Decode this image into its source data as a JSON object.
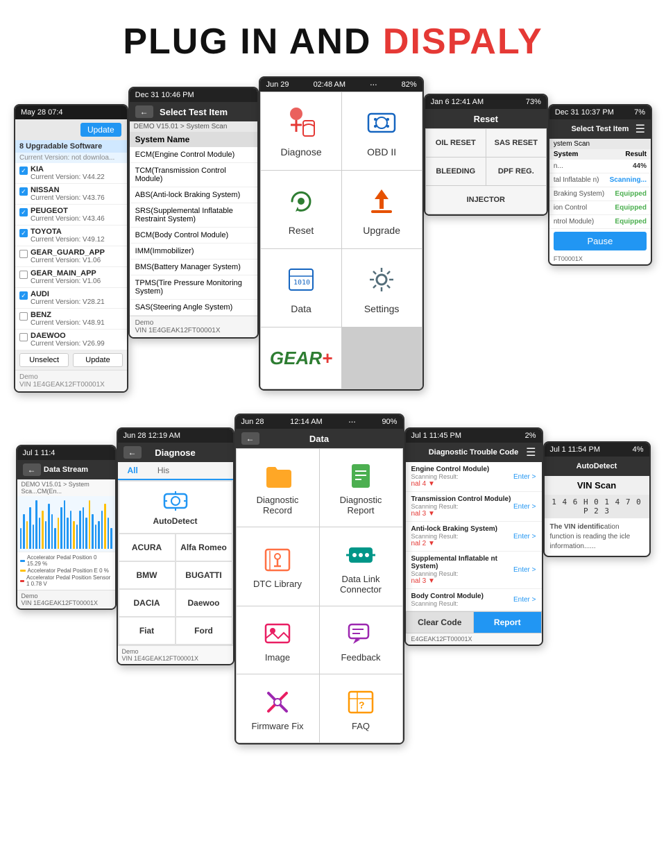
{
  "header": {
    "title_black": "PLUG IN AND ",
    "title_red": "DISPALY"
  },
  "top_row": {
    "update_screen": {
      "status": "May 28  07:4",
      "btn_label": "Update",
      "upgradable": "8 Upgradable Software",
      "current_version": "Current Version: not downloa...",
      "items": [
        {
          "name": "KIA",
          "version": "Current Version: V44.22",
          "checked": true
        },
        {
          "name": "NISSAN",
          "version": "Current Version: V43.76",
          "checked": true
        },
        {
          "name": "PEUGEOT",
          "version": "Current Version: V43.46",
          "checked": true
        },
        {
          "name": "TOYOTA",
          "version": "Current Version: V49.12",
          "checked": true
        },
        {
          "name": "GEAR_GUARD_APP",
          "version": "Current Version: V1.06",
          "checked": false
        },
        {
          "name": "GEAR_MAIN_APP",
          "version": "Current Version: V1.06",
          "checked": false
        },
        {
          "name": "AUDI",
          "version": "Current Version: V28.21",
          "checked": true
        },
        {
          "name": "BENZ",
          "version": "Current Version: V48.91",
          "checked": false
        },
        {
          "name": "DAEWOO",
          "version": "Current Version: V26.99",
          "checked": false
        }
      ],
      "demo": "Demo",
      "vin": "VIN 1E4GEAK12FT00001X",
      "unselect": "Unselect",
      "update": "Update"
    },
    "select_screen": {
      "status": "Dec 31  10:46 PM",
      "title": "Select Test Item",
      "demo_path": "DEMO V15.01 > System Scan",
      "system_name_header": "System Name",
      "items": [
        "ECM(Engine Control Module)",
        "TCM(Transmission Control Module)",
        "ABS(Anti-lock Braking System)",
        "SRS(Supplemental Inflatable Restraint System)",
        "BCM(Body Control Module)",
        "IMM(Immobilizer)",
        "BMS(Battery Manager System)",
        "TPMS(Tire Pressure Monitoring System)",
        "SAS(Steering Angle System)"
      ],
      "demo": "Demo",
      "vin": "VIN 1E4GEAK12FT00001X"
    },
    "main_menu": {
      "status_date": "Jun 29",
      "status_time": "02:48 AM",
      "status_wifi": "WiFi",
      "status_bat": "82%",
      "items": [
        {
          "label": "Diagnose",
          "icon": "diagnose"
        },
        {
          "label": "OBD II",
          "icon": "obd"
        },
        {
          "label": "Reset",
          "icon": "reset"
        },
        {
          "label": "Upgrade",
          "icon": "upgrade"
        },
        {
          "label": "Data",
          "icon": "data"
        },
        {
          "label": "Settings",
          "icon": "settings"
        },
        {
          "label": "GEAR+",
          "icon": "gear"
        }
      ]
    },
    "reset_screen": {
      "status": "Jan 6  12:41 AM",
      "status_wifi": "WiFi",
      "status_bat": "73%",
      "title": "Reset",
      "items": [
        "OIL RESET",
        "SAS RESET",
        "BLEEDING",
        "DPF REG.",
        "INJECTOR"
      ]
    },
    "scan_result_screen": {
      "status": "Dec 31  10:37 PM",
      "status_bat": "7%",
      "title": "Select Test Item",
      "scan_label": "ystem Scan",
      "result_header": "Result",
      "results": [
        {
          "label": "n...",
          "value": "44%",
          "type": "normal"
        },
        {
          "label": "tal Inflatable n)",
          "value": "Scanning...",
          "type": "scanning"
        },
        {
          "label": "Braking System)",
          "value": "Equipped",
          "type": "equipped"
        },
        {
          "label": "ion Control",
          "value": "Equipped",
          "type": "equipped"
        },
        {
          "label": "ntrol Module)",
          "value": "Equipped",
          "type": "equipped"
        }
      ],
      "pause_btn": "Pause",
      "vin": "FT00001X"
    }
  },
  "bottom_row": {
    "datastream_screen": {
      "status": "Jul 1  11:4",
      "title": "Data Stream",
      "path": "DEMO V15.01 > System Sca...CM(En...",
      "legend": [
        {
          "color": "#2196F3",
          "label": "Accelerator Pedal Position 0 15.29 %"
        },
        {
          "color": "#FFC107",
          "label": "Accelerator Pedal Position E 0 %"
        },
        {
          "color": "#e53935",
          "label": "Accelerator Pedal Position Sensor 1 0.78 V"
        }
      ],
      "bars": [
        30,
        50,
        40,
        60,
        35,
        70,
        45,
        55,
        40,
        65,
        50,
        30,
        45,
        60,
        70,
        45,
        55,
        40,
        35,
        55,
        60,
        45,
        70,
        50,
        35,
        40,
        55,
        65,
        45,
        30
      ]
    },
    "diagnose_screen": {
      "status": "Jun 28  12:19 AM",
      "title": "Diagnose",
      "tab_all": "All",
      "tab_his": "His",
      "items": [
        {
          "col1": "AutoDetect",
          "col1_icon": "autodetect"
        },
        {
          "col1": "ACURA",
          "col2": "Alfa Romeo"
        },
        {
          "col1": "BMW",
          "col2": "BUGATTI"
        },
        {
          "col1": "DACIA",
          "col2": "Daewoo"
        },
        {
          "col1": "Fiat",
          "col2": "Ford"
        }
      ],
      "demo": "Demo",
      "vin": "VIN 1E4GEAK12FT00001X"
    },
    "data_screen": {
      "status_date": "Jun 28",
      "status_time": "12:14 AM",
      "status_wifi": "WiFi",
      "status_bat": "90%",
      "title": "Data",
      "items": [
        {
          "label": "Diagnostic Record",
          "icon": "folder"
        },
        {
          "label": "Diagnostic Report",
          "icon": "report"
        },
        {
          "label": "DTC Library",
          "icon": "dtc-lib"
        },
        {
          "label": "Data Link Connector",
          "icon": "connector"
        },
        {
          "label": "Image",
          "icon": "image"
        },
        {
          "label": "Feedback",
          "icon": "feedback"
        },
        {
          "label": "Firmware Fix",
          "icon": "firmware"
        },
        {
          "label": "FAQ",
          "icon": "faq"
        }
      ]
    },
    "dtc_screen": {
      "status": "Jul 1  11:45 PM",
      "status_bat": "2%",
      "title": "Diagnostic Trouble Code",
      "modules": [
        {
          "name": "Engine Control Module)",
          "result": "Scanning Result:",
          "signal": "nal 4",
          "has_arrow": true
        },
        {
          "name": "Transmission Control Module)",
          "result": "Scanning Result:",
          "signal": "nal 3",
          "has_arrow": true
        },
        {
          "name": "Anti-lock Braking System)",
          "result": "Scanning Result:",
          "signal": "nal 2",
          "has_arrow": true
        },
        {
          "name": "Supplemental Inflatable nt System)",
          "result": "Scanning Result:",
          "signal": "nal 3",
          "has_arrow": true
        },
        {
          "name": "Body Control Module)",
          "result": "Scanning Result:",
          "signal": "",
          "has_arrow": false
        }
      ],
      "enter_label": "Enter >",
      "clear_btn": "Clear Code",
      "report_btn": "Report",
      "vin": "E4GEAK12FT00001X"
    },
    "autodetect_screen": {
      "status": "Jul 1  11:54 PM",
      "status_bat": "4%",
      "title": "AutoDetect",
      "vin_scan_title": "VIN Scan",
      "vin_number": "1 4 6 H 0 1 4 7 0 P 2 3",
      "reading_info": "ation function is reading the icle information......"
    }
  }
}
